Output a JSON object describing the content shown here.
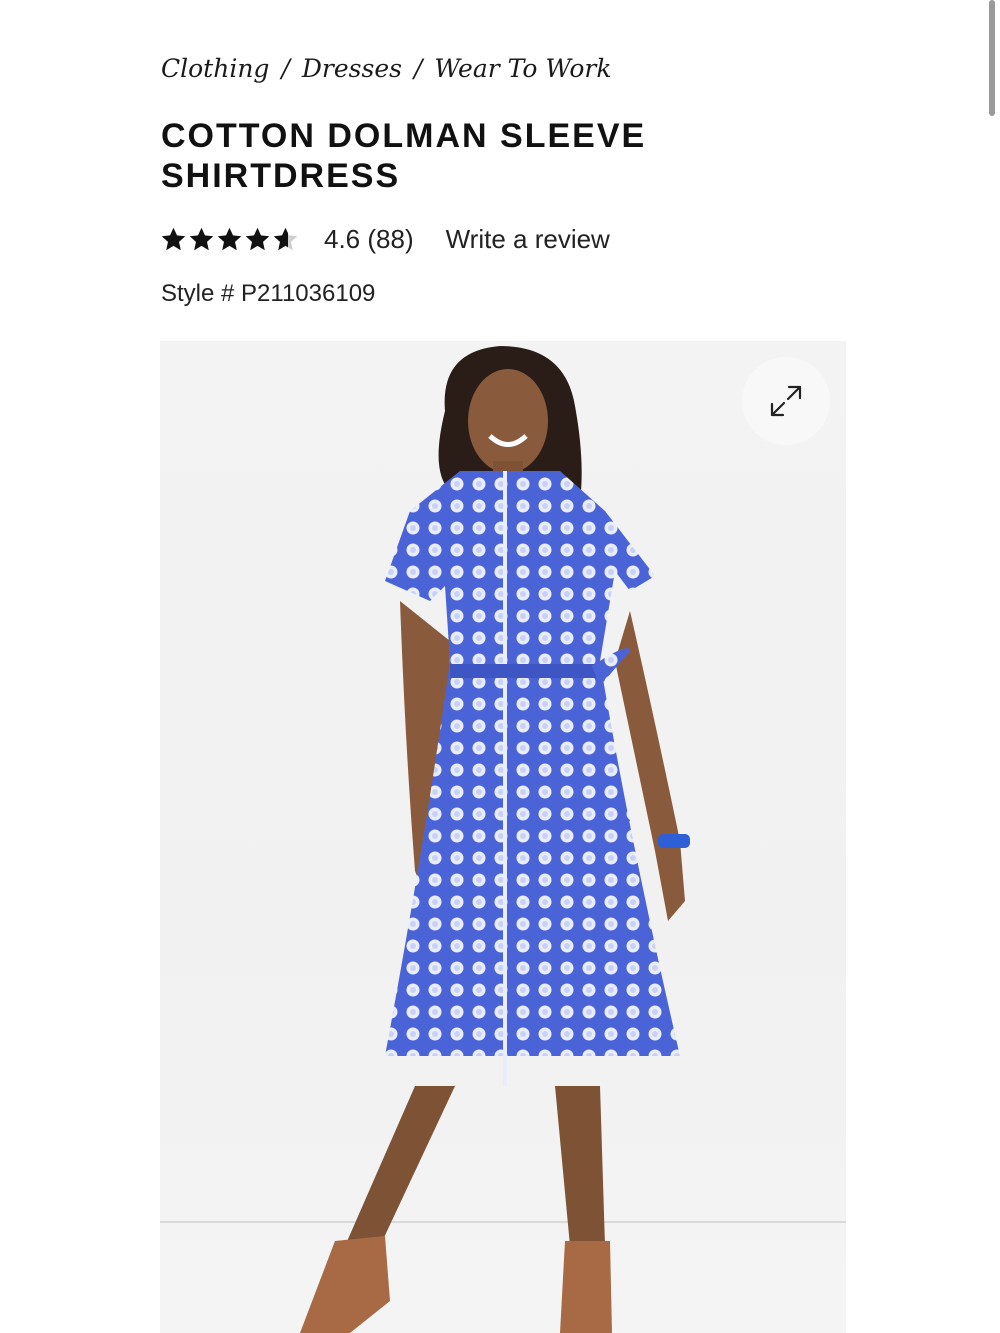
{
  "breadcrumb": {
    "items": [
      "Clothing",
      "Dresses",
      "Wear To Work"
    ],
    "separator": "/"
  },
  "product": {
    "title_line1": "COTTON DOLMAN SLEEVE",
    "title_line2": "SHIRTDRESS",
    "rating_value": 4.6,
    "rating_max": 5,
    "rating_text": "4.6 (88)",
    "write_review_label": "Write a review",
    "style_number": "Style # P211036109"
  },
  "image": {
    "expand_icon": "expand-arrows-icon",
    "dress_color": "#4a64d8"
  },
  "colors": {
    "star": "#111111",
    "star_empty": "#cfcfcf"
  },
  "scroll": {
    "position": 0.0
  }
}
